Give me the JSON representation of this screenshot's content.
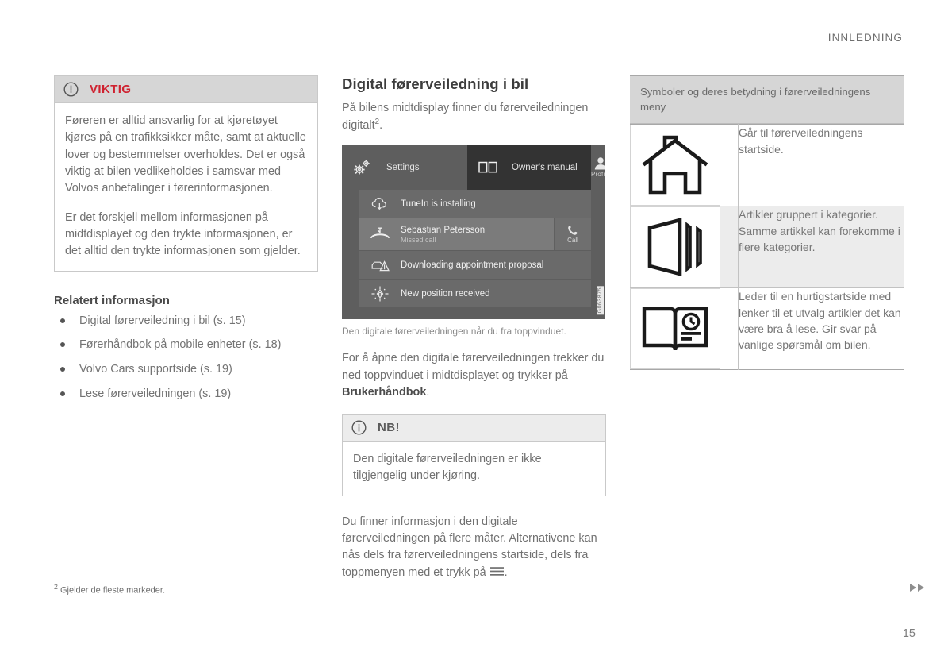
{
  "header": {
    "title": "INNLEDNING"
  },
  "page_number": "15",
  "nav_marker": {
    "icon": "double-chevron-right-icon"
  },
  "left_column": {
    "warning_box": {
      "icon": "exclamation-circle-icon",
      "title": "VIKTIG",
      "title_color": "#cf2230",
      "paragraphs": [
        "Føreren er alltid ansvarlig for at kjøretøyet kjøres på en trafikksikker måte, samt at aktuelle lover og bestemmelser overholdes. Det er også viktig at bilen vedlikeholdes i samsvar med Volvos anbefalinger i førerinformasjonen.",
        "Er det forskjell mellom informasjonen på midtdisplayet og den trykte informasjonen, er det alltid den trykte informasjonen som gjelder."
      ]
    },
    "related": {
      "heading": "Relatert informasjon",
      "items": [
        "Digital førerveiledning i bil (s. 15)",
        "Førerhåndbok på mobile enheter (s. 18)",
        "Volvo Cars supportside (s. 19)",
        "Lese førerveiledningen (s. 19)"
      ]
    }
  },
  "middle_column": {
    "heading": "Digital førerveiledning i bil",
    "intro_before": "På bilens midtdisplay finner du førerveiledningen digitalt",
    "intro_sup": "2",
    "intro_after": ".",
    "mockup": {
      "tabs": [
        {
          "icon": "gears-icon",
          "label": "Settings",
          "active": false
        },
        {
          "icon": "open-book-icon",
          "label": "Owner's manual",
          "active": true
        },
        {
          "icon": "person-icon",
          "label": "Profile",
          "active": false
        }
      ],
      "notifications": [
        {
          "icon": "cloud-download-icon",
          "title": "TuneIn is installing",
          "subtitle": "",
          "action": "",
          "highlighted": false
        },
        {
          "icon": "missed-call-icon",
          "title": "Sebastian Petersson",
          "subtitle": "Missed call",
          "action": "Call",
          "action_icon": "phone-handset-icon",
          "highlighted": true
        },
        {
          "icon": "car-warning-icon",
          "title": "Downloading appointment proposal",
          "subtitle": "",
          "action": "",
          "highlighted": false
        },
        {
          "icon": "compass-icon",
          "title": "New position received",
          "subtitle": "",
          "action": "",
          "highlighted": false
        }
      ],
      "image_id": "G063875"
    },
    "caption": "Den digitale førerveiledningen når du fra toppvinduet.",
    "body_before_bold": "For å åpne den digitale førerveiledningen trekker du ned toppvinduet i midtdisplayet og trykker på ",
    "body_bold": "Brukerhåndbok",
    "body_after_bold": ".",
    "note_box": {
      "icon": "info-circle-icon",
      "title": "NB!",
      "paragraphs": [
        "Den digitale førerveiledningen er ikke tilgjengelig under kjøring."
      ]
    },
    "closing_before_icon": "Du finner informasjon i den digitale førerveiledningen på flere måter. Alternativene kan nås dels fra førerveiledningens startside, dels fra toppmenyen med et trykk på ",
    "closing_icon": "hamburger-menu-icon",
    "closing_after_icon": "."
  },
  "right_column": {
    "table": {
      "caption": "Symboler og deres betydning i førerveiledningens meny",
      "rows": [
        {
          "icon": "house-icon",
          "description": "Går til førerveiledningens startside.",
          "shaded": false
        },
        {
          "icon": "categories-folder-icon",
          "description": "Artikler gruppert i kategorier. Samme artikkel kan forekomme i flere kategorier.",
          "shaded": true
        },
        {
          "icon": "book-clock-icon",
          "description": "Leder til en hurtigstartside med lenker til et utvalg artikler det kan være bra å lese. Gir svar på vanlige spørsmål om bilen.",
          "shaded": false
        }
      ]
    }
  },
  "footnote": {
    "marker": "2",
    "text": "Gjelder de fleste markeder."
  }
}
